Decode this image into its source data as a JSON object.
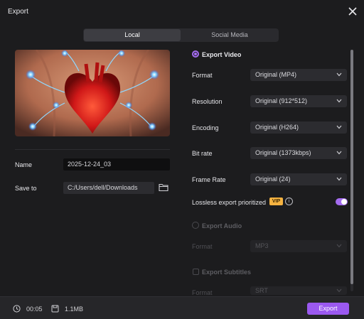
{
  "window": {
    "title": "Export"
  },
  "tabs": [
    {
      "label": "Local",
      "active": true
    },
    {
      "label": "Social Media",
      "active": false
    }
  ],
  "left": {
    "name_label": "Name",
    "name_value": "2025-12-24_03",
    "save_label": "Save to",
    "save_value": "C:/Users/dell/Downloads"
  },
  "export_video": {
    "label": "Export Video",
    "rows": [
      {
        "label": "Format",
        "value": "Original (MP4)"
      },
      {
        "label": "Resolution",
        "value": "Original (912*512)"
      },
      {
        "label": "Encoding",
        "value": "Original (H264)"
      },
      {
        "label": "Bit rate",
        "value": "Original (1373kbps)"
      },
      {
        "label": "Frame Rate",
        "value": "Original (24)"
      }
    ],
    "lossless_label": "Lossless export prioritized",
    "vip_badge": "VIP",
    "info_glyph": "i"
  },
  "export_audio": {
    "label": "Export Audio",
    "row_label": "Format",
    "row_value": "MP3"
  },
  "export_subtitles": {
    "label": "Export Subtitles",
    "row_label": "Format",
    "row_value": "SRT"
  },
  "footer": {
    "duration": "00:05",
    "size": "1.1MB",
    "export_label": "Export"
  },
  "colors": {
    "accent": "#9b59f0",
    "vip": "#f5b341",
    "background": "#1c1c1e"
  },
  "icons": [
    "close-icon",
    "folder-icon",
    "chevron-down-icon",
    "clock-icon",
    "file-size-icon",
    "info-icon"
  ]
}
